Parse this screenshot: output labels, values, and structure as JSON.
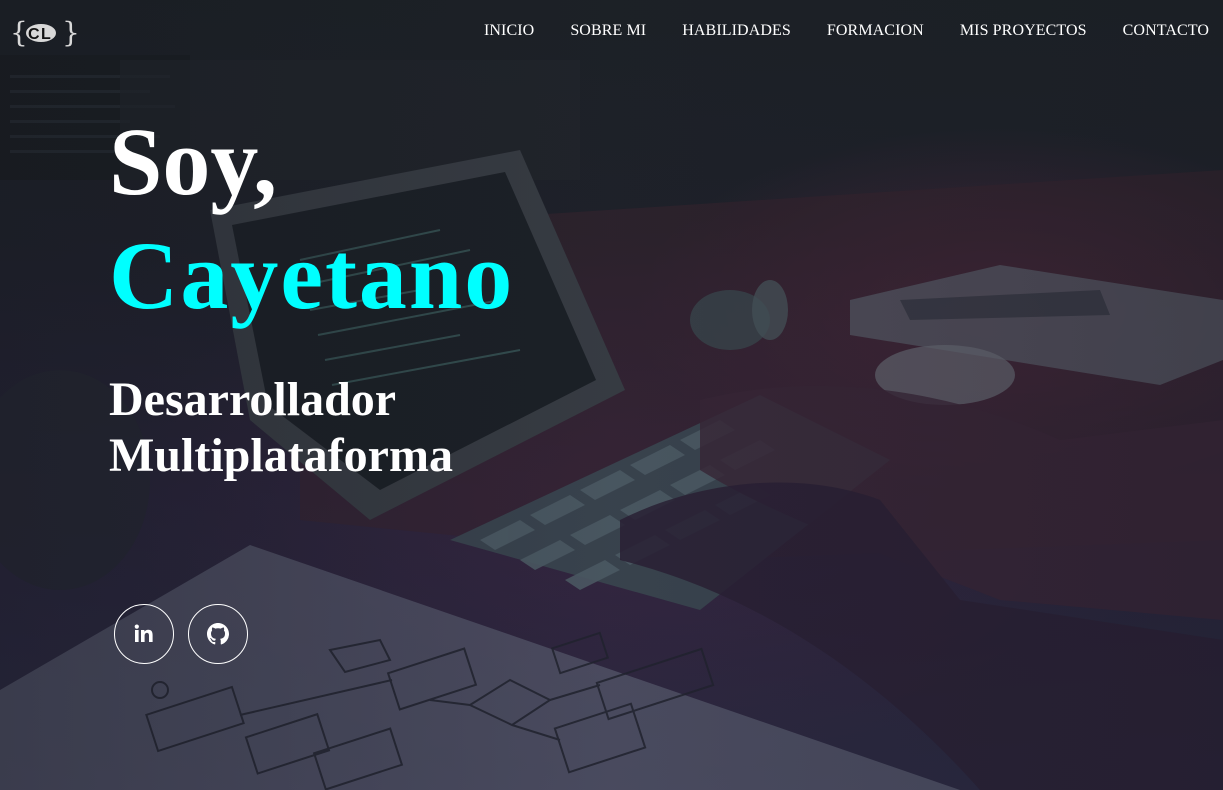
{
  "header": {
    "logo_text": "{CL}",
    "nav": [
      {
        "label": "INICIO"
      },
      {
        "label": "SOBRE MI"
      },
      {
        "label": "HABILIDADES"
      },
      {
        "label": "FORMACION"
      },
      {
        "label": "MIS PROYECTOS"
      },
      {
        "label": "CONTACTO"
      }
    ]
  },
  "hero": {
    "greeting": "Soy,",
    "name": "Cayetano",
    "role_line1": "Desarrollador",
    "role_line2": "Multiplataforma"
  },
  "socials": [
    {
      "name": "linkedin",
      "icon": "linkedin-icon"
    },
    {
      "name": "github",
      "icon": "github-icon"
    }
  ],
  "colors": {
    "accent": "#00ffff",
    "text": "#ffffff",
    "background": "#1f222b"
  }
}
